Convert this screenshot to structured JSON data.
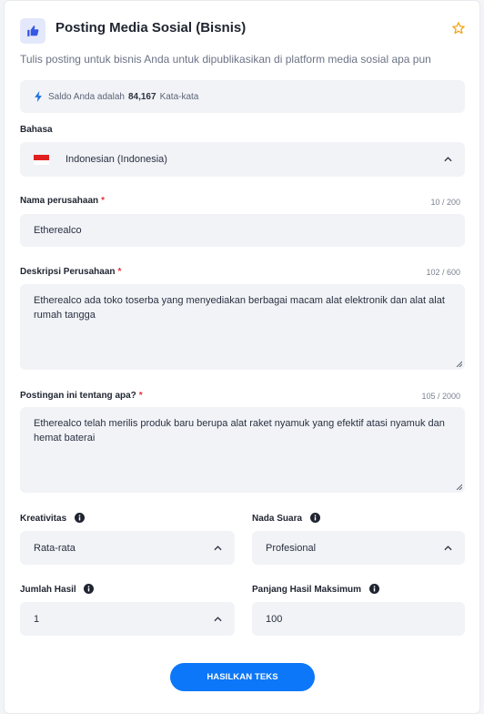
{
  "header": {
    "title": "Posting Media Sosial (Bisnis)",
    "subtitle": "Tulis posting untuk bisnis Anda untuk dipublikasikan di platform media sosial apa pun",
    "icon": "thumbs-up-icon",
    "accent": "#0c77f8"
  },
  "balance": {
    "prefix": "Saldo Anda adalah",
    "amount": "84,167",
    "suffix": "Kata-kata"
  },
  "language": {
    "label": "Bahasa",
    "value": "Indonesian (Indonesia)"
  },
  "company_name": {
    "label": "Nama perusahaan",
    "required": "*",
    "counter": "10 / 200",
    "value": "Etherealco"
  },
  "company_description": {
    "label": "Deskripsi Perusahaan",
    "required": "*",
    "counter": "102 / 600",
    "value": "Etherealco ada toko toserba yang menyediakan berbagai macam alat elektronik dan alat alat rumah tangga"
  },
  "post_topic": {
    "label": "Postingan ini tentang apa?",
    "required": "*",
    "counter": "105 / 2000",
    "value": "Etherealco telah merilis produk baru berupa alat raket nyamuk yang efektif atasi nyamuk dan hemat baterai"
  },
  "creativity": {
    "label": "Kreativitas",
    "value": "Rata-rata"
  },
  "tone": {
    "label": "Nada Suara",
    "value": "Profesional"
  },
  "result_count": {
    "label": "Jumlah Hasil",
    "value": "1"
  },
  "max_length": {
    "label": "Panjang Hasil Maksimum",
    "value": "100"
  },
  "submit": {
    "label": "HASILKAN TEKS"
  }
}
